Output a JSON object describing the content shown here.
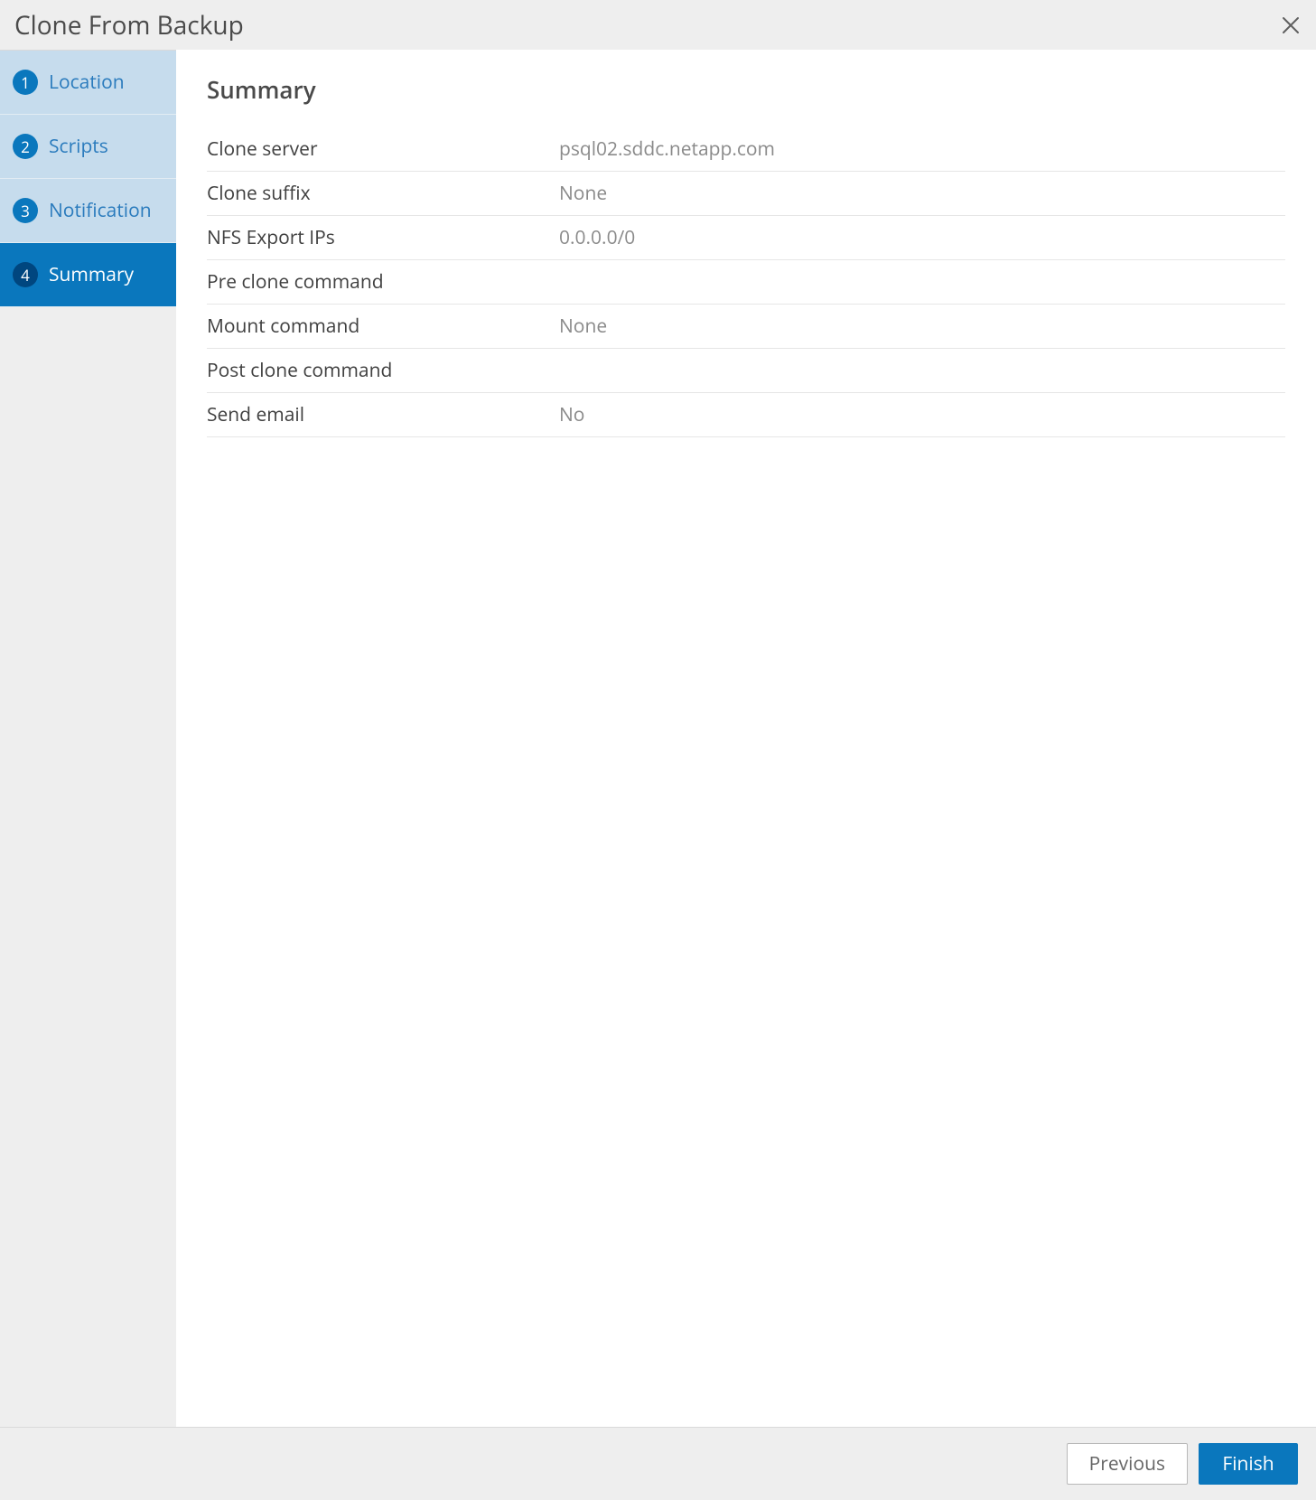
{
  "title": "Clone From Backup",
  "steps": [
    {
      "num": "1",
      "label": "Location",
      "state": "completed"
    },
    {
      "num": "2",
      "label": "Scripts",
      "state": "completed"
    },
    {
      "num": "3",
      "label": "Notification",
      "state": "completed"
    },
    {
      "num": "4",
      "label": "Summary",
      "state": "active"
    }
  ],
  "main": {
    "heading": "Summary",
    "rows": [
      {
        "key": "Clone server",
        "val": "psql02.sddc.netapp.com"
      },
      {
        "key": "Clone suffix",
        "val": "None"
      },
      {
        "key": "NFS Export IPs",
        "val": "0.0.0.0/0"
      },
      {
        "key": "Pre clone command",
        "val": ""
      },
      {
        "key": "Mount command",
        "val": "None"
      },
      {
        "key": "Post clone command",
        "val": ""
      },
      {
        "key": "Send email",
        "val": "No"
      }
    ]
  },
  "footer": {
    "previous": "Previous",
    "finish": "Finish"
  }
}
